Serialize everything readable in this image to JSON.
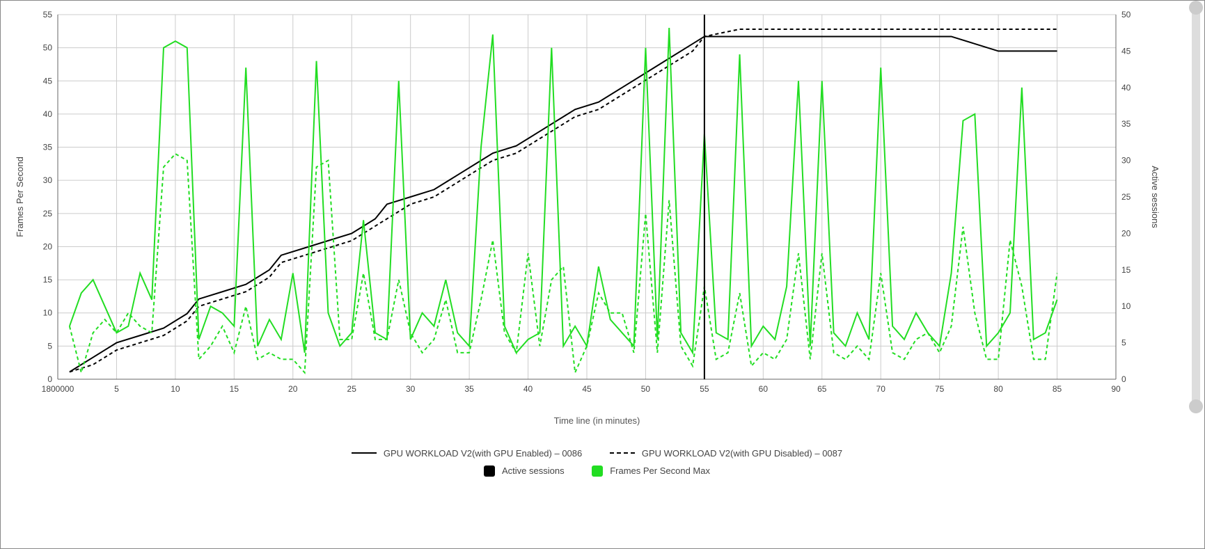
{
  "chart_data": {
    "type": "line",
    "xlabel": "Time line (in minutes)",
    "ylabel_left": "Frames Per Second",
    "ylabel_right": "Active sessions",
    "xlim": [
      0,
      90
    ],
    "ylim_left": [
      0,
      55
    ],
    "ylim_right": [
      0,
      50
    ],
    "x_ticks": [
      "1800000",
      5,
      10,
      15,
      20,
      25,
      30,
      35,
      40,
      45,
      50,
      55,
      60,
      65,
      70,
      75,
      80,
      85,
      90
    ],
    "y_ticks_left": [
      0,
      5,
      10,
      15,
      20,
      25,
      30,
      35,
      40,
      45,
      50,
      55
    ],
    "y_ticks_right": [
      0,
      5,
      10,
      15,
      20,
      25,
      30,
      35,
      40,
      45,
      50
    ],
    "cursor_x": 55,
    "legend_line_style": {
      "solid": "GPU WORKLOAD V2(with GPU Enabled) – 0086",
      "dashed": "GPU WORKLOAD V2(with GPU Disabled) – 0087"
    },
    "legend_color": {
      "black": "Active sessions",
      "green": "Frames Per Second Max"
    },
    "series": [
      {
        "name": "Active sessions (0086 solid)",
        "axis": "right",
        "style": "solid",
        "color": "#000000",
        "x": [
          1,
          3,
          4,
          5,
          7,
          9,
          11,
          12,
          14,
          16,
          18,
          19,
          21,
          23,
          25,
          27,
          28,
          30,
          32,
          34,
          36,
          37,
          39,
          41,
          43,
          44,
          46,
          48,
          50,
          52,
          54,
          55,
          57,
          60,
          65,
          70,
          74,
          76,
          78,
          80,
          85
        ],
        "y": [
          1,
          3,
          4,
          5,
          6,
          7,
          9,
          11,
          12,
          13,
          15,
          17,
          18,
          19,
          20,
          22,
          24,
          25,
          26,
          28,
          30,
          31,
          32,
          34,
          36,
          37,
          38,
          40,
          42,
          44,
          46,
          47,
          47,
          47,
          47,
          47,
          47,
          47,
          46,
          45,
          45
        ]
      },
      {
        "name": "Active sessions (0087 dashed)",
        "axis": "right",
        "style": "dashed",
        "color": "#000000",
        "x": [
          1,
          3,
          5,
          7,
          9,
          11,
          12,
          14,
          16,
          18,
          19,
          21,
          23,
          25,
          27,
          28,
          30,
          32,
          34,
          36,
          37,
          39,
          41,
          43,
          44,
          46,
          48,
          50,
          52,
          54,
          55,
          58,
          65,
          75,
          85
        ],
        "y": [
          1,
          2,
          4,
          5,
          6,
          8,
          10,
          11,
          12,
          14,
          16,
          17,
          18,
          19,
          21,
          22,
          24,
          25,
          27,
          29,
          30,
          31,
          33,
          35,
          36,
          37,
          39,
          41,
          43,
          45,
          47,
          48,
          48,
          48,
          48
        ]
      },
      {
        "name": "FPS Max (0086 solid)",
        "axis": "left",
        "style": "solid",
        "color": "#22dd22",
        "x": [
          1,
          2,
          3,
          4,
          5,
          6,
          7,
          8,
          9,
          10,
          11,
          12,
          13,
          14,
          15,
          16,
          17,
          18,
          19,
          20,
          21,
          22,
          23,
          24,
          25,
          26,
          27,
          28,
          29,
          30,
          31,
          32,
          33,
          34,
          35,
          36,
          37,
          38,
          39,
          40,
          41,
          42,
          43,
          44,
          45,
          46,
          47,
          48,
          49,
          50,
          51,
          52,
          53,
          54,
          55,
          56,
          57,
          58,
          59,
          60,
          61,
          62,
          63,
          64,
          65,
          66,
          67,
          68,
          69,
          70,
          71,
          72,
          73,
          74,
          75,
          76,
          77,
          78,
          79,
          80,
          81,
          82,
          83,
          84,
          85
        ],
        "y": [
          8,
          13,
          15,
          11,
          7,
          8,
          16,
          12,
          50,
          51,
          50,
          6,
          11,
          10,
          8,
          47,
          5,
          9,
          6,
          16,
          4,
          48,
          10,
          5,
          7,
          24,
          7,
          6,
          45,
          6,
          10,
          8,
          15,
          7,
          5,
          35,
          52,
          8,
          4,
          6,
          7,
          50,
          5,
          8,
          5,
          17,
          9,
          7,
          5,
          50,
          6,
          53,
          7,
          4,
          37,
          7,
          6,
          49,
          5,
          8,
          6,
          14,
          45,
          5,
          45,
          7,
          5,
          10,
          6,
          47,
          8,
          6,
          10,
          7,
          5,
          16,
          39,
          40,
          5,
          7,
          10,
          44,
          6,
          7,
          12
        ]
      },
      {
        "name": "FPS Max (0087 dashed)",
        "axis": "left",
        "style": "dashed",
        "color": "#22dd22",
        "x": [
          1,
          2,
          3,
          4,
          5,
          6,
          7,
          8,
          9,
          10,
          11,
          12,
          13,
          14,
          15,
          16,
          17,
          18,
          19,
          20,
          21,
          22,
          23,
          24,
          25,
          26,
          27,
          28,
          29,
          30,
          31,
          32,
          33,
          34,
          35,
          36,
          37,
          38,
          39,
          40,
          41,
          42,
          43,
          44,
          45,
          46,
          47,
          48,
          49,
          50,
          51,
          52,
          53,
          54,
          55,
          56,
          57,
          58,
          59,
          60,
          61,
          62,
          63,
          64,
          65,
          66,
          67,
          68,
          69,
          70,
          71,
          72,
          73,
          74,
          75,
          76,
          77,
          78,
          79,
          80,
          81,
          82,
          83,
          84,
          85
        ],
        "y": [
          8,
          1,
          7,
          9,
          7,
          10,
          8,
          7,
          32,
          34,
          33,
          3,
          5,
          8,
          4,
          11,
          3,
          4,
          3,
          3,
          1,
          32,
          33,
          6,
          6,
          16,
          6,
          6,
          15,
          7,
          4,
          6,
          12,
          4,
          4,
          12,
          21,
          7,
          4,
          19,
          5,
          15,
          17,
          1,
          5,
          13,
          10,
          10,
          4,
          25,
          4,
          27,
          5,
          2,
          14,
          3,
          4,
          13,
          2,
          4,
          3,
          6,
          19,
          3,
          19,
          4,
          3,
          5,
          3,
          16,
          4,
          3,
          6,
          7,
          4,
          8,
          23,
          10,
          3,
          3,
          21,
          14,
          3,
          3,
          16
        ]
      }
    ]
  },
  "colors": {
    "green": "#22dd22",
    "black": "#000000",
    "grid": "#cccccc",
    "axis": "#666666"
  }
}
